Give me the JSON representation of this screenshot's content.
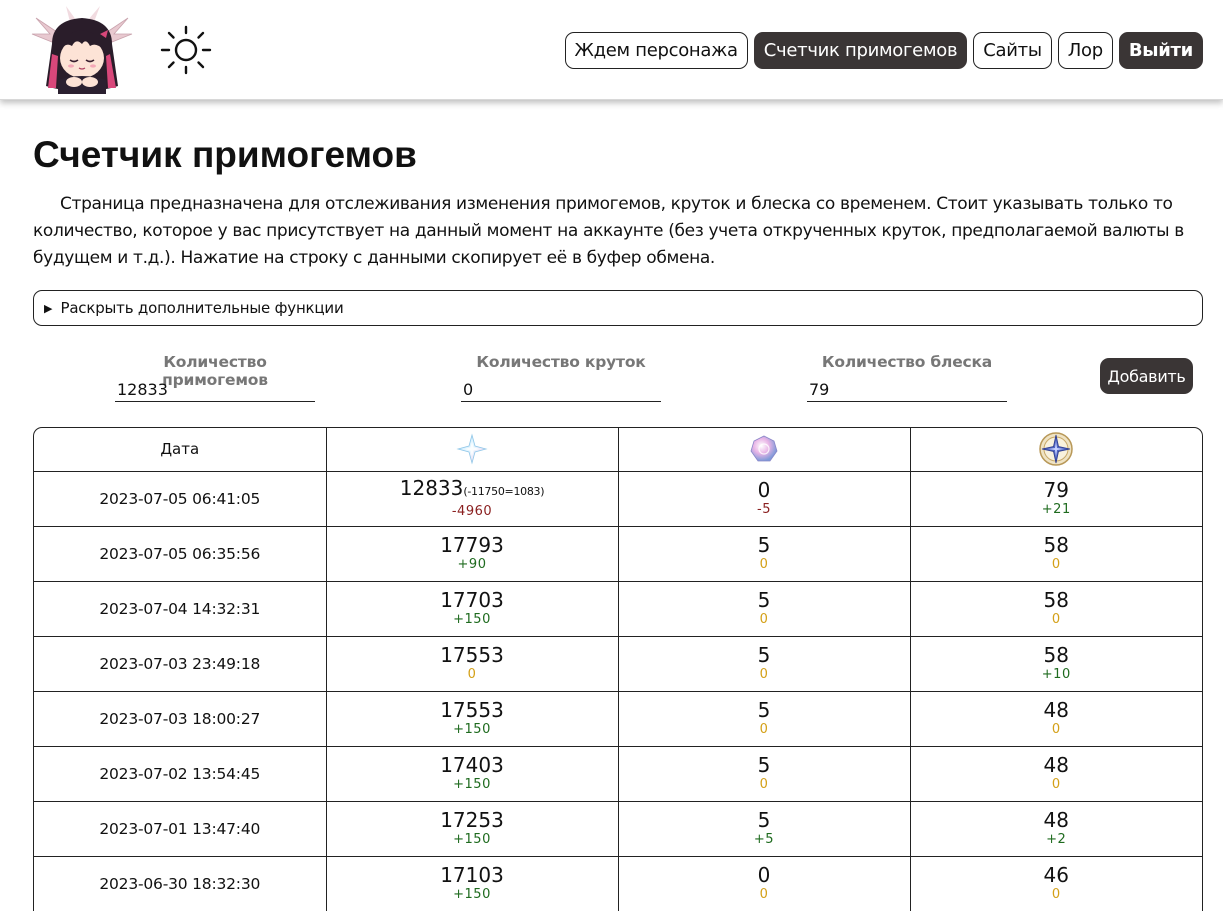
{
  "header": {
    "avatar_icon": "chibi-character-avatar",
    "theme_icon": "sun-icon",
    "nav": [
      {
        "label": "Ждем персонажа",
        "active": false
      },
      {
        "label": "Счетчик примогемов",
        "active": true
      },
      {
        "label": "Сайты",
        "active": false
      },
      {
        "label": "Лор",
        "active": false
      }
    ],
    "logout_label": "Выйти"
  },
  "main": {
    "title": "Счетчик примогемов",
    "description": "Страница предназначена для отслеживания изменения примогемов, круток и блеска со временем. Стоит указывать только то количество, которое у вас присутствует на данный момент на аккаунте (без учета открученных круток, предполагаемой валюты в будущем и т.д.). Нажатие на строку с данными скопирует её в буфер обмена.",
    "details_label": "Раскрыть дополнительные функции"
  },
  "form": {
    "primogems_label": "Количество примогемов",
    "primogems_value": "12833",
    "wishes_label": "Количество круток",
    "wishes_value": "0",
    "starglitter_label": "Количество блеска",
    "starglitter_value": "79",
    "add_label": "Добавить"
  },
  "table": {
    "headers": {
      "date": "Дата",
      "primogem_icon": "primogem-icon",
      "wish_icon": "intertwined-fate-icon",
      "starglitter_icon": "masterless-starglitter-icon"
    },
    "rows": [
      {
        "date": "2023-07-05 06:41:05",
        "primo": "12833",
        "primo_extra": "(-11750=1083)",
        "primo_delta": "-4960",
        "wish": "0",
        "wish_delta": "-5",
        "star": "79",
        "star_delta": "+21"
      },
      {
        "date": "2023-07-05 06:35:56",
        "primo": "17793",
        "primo_extra": "",
        "primo_delta": "+90",
        "wish": "5",
        "wish_delta": "0",
        "star": "58",
        "star_delta": "0"
      },
      {
        "date": "2023-07-04 14:32:31",
        "primo": "17703",
        "primo_extra": "",
        "primo_delta": "+150",
        "wish": "5",
        "wish_delta": "0",
        "star": "58",
        "star_delta": "0"
      },
      {
        "date": "2023-07-03 23:49:18",
        "primo": "17553",
        "primo_extra": "",
        "primo_delta": "0",
        "wish": "5",
        "wish_delta": "0",
        "star": "58",
        "star_delta": "+10"
      },
      {
        "date": "2023-07-03 18:00:27",
        "primo": "17553",
        "primo_extra": "",
        "primo_delta": "+150",
        "wish": "5",
        "wish_delta": "0",
        "star": "48",
        "star_delta": "0"
      },
      {
        "date": "2023-07-02 13:54:45",
        "primo": "17403",
        "primo_extra": "",
        "primo_delta": "+150",
        "wish": "5",
        "wish_delta": "0",
        "star": "48",
        "star_delta": "0"
      },
      {
        "date": "2023-07-01 13:47:40",
        "primo": "17253",
        "primo_extra": "",
        "primo_delta": "+150",
        "wish": "5",
        "wish_delta": "+5",
        "star": "48",
        "star_delta": "+2"
      },
      {
        "date": "2023-06-30 18:32:30",
        "primo": "17103",
        "primo_extra": "",
        "primo_delta": "+150",
        "wish": "0",
        "wish_delta": "0",
        "star": "46",
        "star_delta": "0"
      }
    ]
  },
  "colors": {
    "dark_button": "#3a3535",
    "delta_positive": "#1f6b1f",
    "delta_negative": "#8a1f1f",
    "delta_zero": "#d4a017"
  }
}
